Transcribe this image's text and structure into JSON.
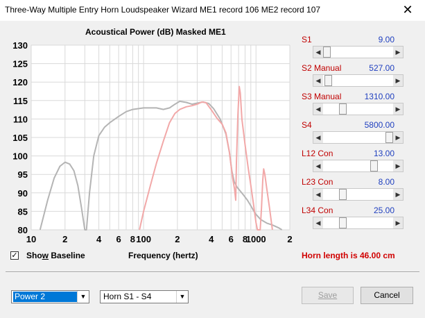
{
  "window": {
    "title": "Three-Way Multiple Entry Horn Loudspeaker Wizard    ME1 record 106    ME2 record 107",
    "close_glyph": "✕"
  },
  "chart_data": {
    "type": "line",
    "title": "Acoustical Power (dB)   Masked   ME1",
    "xlabel": "Frequency (hertz)",
    "ylabel": "",
    "xscale": "log",
    "xlim": [
      10,
      2000
    ],
    "ylim": [
      80,
      130
    ],
    "y_ticks": [
      80,
      85,
      90,
      95,
      100,
      105,
      110,
      115,
      120,
      125,
      130
    ],
    "x_ticks": [
      {
        "value": 10,
        "label": "10"
      },
      {
        "value": 20,
        "label": "2"
      },
      {
        "value": 40,
        "label": "4"
      },
      {
        "value": 60,
        "label": "6"
      },
      {
        "value": 80,
        "label": "8"
      },
      {
        "value": 100,
        "label": "100"
      },
      {
        "value": 200,
        "label": "2"
      },
      {
        "value": 400,
        "label": "4"
      },
      {
        "value": 600,
        "label": "6"
      },
      {
        "value": 800,
        "label": "8"
      },
      {
        "value": 1000,
        "label": "1000"
      },
      {
        "value": 2000,
        "label": "2"
      }
    ],
    "grid": true,
    "series": [
      {
        "color": "#b4b4b4",
        "points": [
          [
            12,
            80
          ],
          [
            14,
            88
          ],
          [
            16,
            94
          ],
          [
            18,
            97.2
          ],
          [
            20,
            98.3
          ],
          [
            22,
            97.8
          ],
          [
            24,
            96
          ],
          [
            26,
            92
          ],
          [
            28,
            86
          ],
          [
            30,
            80
          ],
          [
            31,
            80
          ],
          [
            33,
            90
          ],
          [
            36,
            100
          ],
          [
            40,
            105.5
          ],
          [
            45,
            107.8
          ],
          [
            50,
            109
          ],
          [
            60,
            110.7
          ],
          [
            70,
            112
          ],
          [
            80,
            112.6
          ],
          [
            100,
            113
          ],
          [
            130,
            113
          ],
          [
            150,
            112.6
          ],
          [
            170,
            113
          ],
          [
            190,
            114
          ],
          [
            210,
            114.8
          ],
          [
            240,
            114.5
          ],
          [
            270,
            114
          ],
          [
            300,
            114.3
          ],
          [
            340,
            114.6
          ],
          [
            380,
            114.2
          ],
          [
            420,
            112.8
          ],
          [
            480,
            110
          ],
          [
            540,
            106
          ],
          [
            580,
            101
          ],
          [
            610,
            96
          ],
          [
            640,
            93
          ],
          [
            680,
            91.5
          ],
          [
            720,
            90.6
          ],
          [
            780,
            89.3
          ],
          [
            840,
            88
          ],
          [
            900,
            86.5
          ],
          [
            960,
            85
          ],
          [
            1000,
            84.2
          ],
          [
            1100,
            82.8
          ],
          [
            1250,
            81.8
          ],
          [
            1400,
            81.3
          ],
          [
            1600,
            80.5
          ],
          [
            1700,
            80
          ]
        ]
      },
      {
        "color": "#f2a8a8",
        "points": [
          [
            92,
            80
          ],
          [
            100,
            85
          ],
          [
            115,
            92
          ],
          [
            130,
            98
          ],
          [
            150,
            104
          ],
          [
            170,
            109
          ],
          [
            190,
            111.5
          ],
          [
            210,
            112.6
          ],
          [
            240,
            113.3
          ],
          [
            270,
            113.6
          ],
          [
            300,
            114
          ],
          [
            330,
            114.6
          ],
          [
            360,
            114.4
          ],
          [
            400,
            112.5
          ],
          [
            450,
            110.2
          ],
          [
            500,
            108.6
          ],
          [
            540,
            106.3
          ],
          [
            580,
            101
          ],
          [
            620,
            94
          ],
          [
            645,
            91
          ],
          [
            660,
            88
          ],
          [
            670,
            98
          ],
          [
            690,
            111
          ],
          [
            710,
            118.8
          ],
          [
            725,
            117
          ],
          [
            750,
            110
          ],
          [
            800,
            103
          ],
          [
            850,
            97
          ],
          [
            900,
            92
          ],
          [
            950,
            87
          ],
          [
            1000,
            82
          ],
          [
            1030,
            80
          ],
          [
            1090,
            80
          ],
          [
            1120,
            86
          ],
          [
            1150,
            93.5
          ],
          [
            1170,
            96.5
          ],
          [
            1200,
            95
          ],
          [
            1250,
            91
          ],
          [
            1320,
            86
          ],
          [
            1400,
            80
          ]
        ]
      }
    ]
  },
  "params": [
    {
      "label": "S1",
      "value": "9.00",
      "thumb": 0.0
    },
    {
      "label": "S2  Manual",
      "value": "527.00",
      "thumb": 0.02
    },
    {
      "label": "S3  Manual",
      "value": "1310.00",
      "thumb": 0.25
    },
    {
      "label": "S4",
      "value": "5800.00",
      "thumb": 1.0
    },
    {
      "label": "L12  Con",
      "value": "13.00",
      "thumb": 0.76
    },
    {
      "label": "L23  Con",
      "value": "8.00",
      "thumb": 0.25
    },
    {
      "label": "L34  Con",
      "value": "25.00",
      "thumb": 0.25
    }
  ],
  "controls": {
    "show_baseline_checked": "✓",
    "show_baseline_pre": "Sho",
    "show_baseline_accel": "w",
    "show_baseline_post": " Baseline",
    "frequency_label": "Frequency (hertz)",
    "horn_length": "Horn length is 46.00 cm",
    "mode_select": "Power 2",
    "horn_select": "Horn S1 - S4",
    "save_label": "Save",
    "cancel_label": "Cancel",
    "dropdown_glyph": "▼",
    "left_glyph": "◀",
    "right_glyph": "▶"
  }
}
